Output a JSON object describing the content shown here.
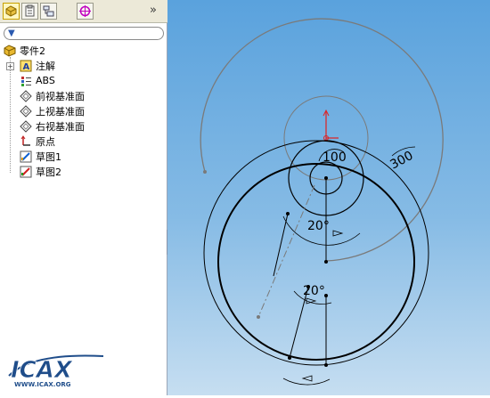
{
  "panel": {
    "collapse_glyph": "»",
    "tabs": [
      {
        "icon": "feature-manager-icon",
        "active": true
      },
      {
        "icon": "property-manager-icon",
        "active": false
      },
      {
        "icon": "configuration-manager-icon",
        "active": false
      },
      {
        "icon": "dimxpert-icon",
        "active": false
      }
    ],
    "filter_icon": "filter-icon"
  },
  "tree": {
    "root": "零件2",
    "items": [
      {
        "label": "注解",
        "icon": "annotation-icon"
      },
      {
        "label": "ABS",
        "icon": "material-icon"
      },
      {
        "label": "前视基准面",
        "icon": "plane-icon"
      },
      {
        "label": "上视基准面",
        "icon": "plane-icon"
      },
      {
        "label": "右视基准面",
        "icon": "plane-icon"
      },
      {
        "label": "原点",
        "icon": "origin-icon"
      },
      {
        "label": "草图1",
        "icon": "sketch-icon"
      },
      {
        "label": "草图2",
        "icon": "sketch-icon"
      }
    ]
  },
  "sketch": {
    "dimensions": {
      "dim1": "100",
      "dim2": "300",
      "angle1": "20°",
      "angle2": "20°"
    }
  },
  "logo": {
    "text": "ICAX",
    "subtext": "WWW.ICAX.ORG"
  },
  "colors": {
    "canvas_top": "#5aa2dd",
    "canvas_bottom": "#c6def1",
    "sketch_line": "#000000",
    "construction_line": "#808080",
    "origin": "#e02020"
  }
}
